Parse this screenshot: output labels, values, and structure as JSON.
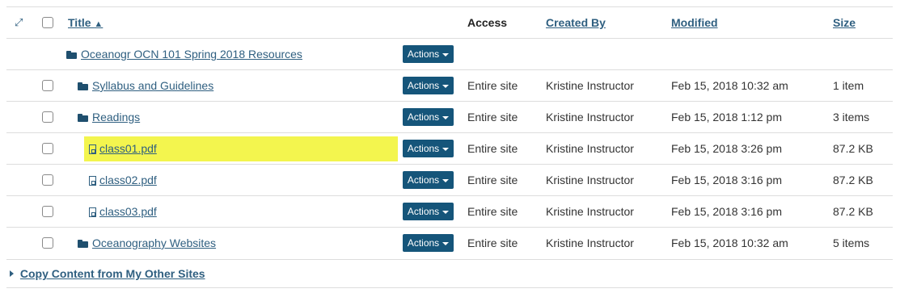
{
  "header": {
    "expand_icon": "expand-icon",
    "title": "Title",
    "access": "Access",
    "created_by": "Created By",
    "modified": "Modified",
    "size": "Size"
  },
  "rows": [
    {
      "name": "Oceanogr OCN 101 Spring 2018 Resources",
      "type": "folder-open",
      "actions": "Actions",
      "access": "",
      "created_by": "",
      "modified": "",
      "size": "",
      "has_checkbox": false
    },
    {
      "name": "Syllabus and Guidelines",
      "type": "folder",
      "actions": "Actions",
      "access": "Entire site",
      "created_by": "Kristine Instructor",
      "modified": "Feb 15, 2018 10:32 am",
      "size": "1 item",
      "has_checkbox": true
    },
    {
      "name": "Readings",
      "type": "folder-open",
      "actions": "Actions",
      "access": "Entire site",
      "created_by": "Kristine Instructor",
      "modified": "Feb 15, 2018 1:12 pm",
      "size": "3 items",
      "has_checkbox": true
    },
    {
      "name": "class01.pdf",
      "type": "pdf",
      "highlighted": true,
      "actions": "Actions",
      "access": "Entire site",
      "created_by": "Kristine Instructor",
      "modified": "Feb 15, 2018 3:26 pm",
      "size": "87.2 KB",
      "has_checkbox": true
    },
    {
      "name": "class02.pdf",
      "type": "pdf",
      "actions": "Actions",
      "access": "Entire site",
      "created_by": "Kristine Instructor",
      "modified": "Feb 15, 2018 3:16 pm",
      "size": "87.2 KB",
      "has_checkbox": true
    },
    {
      "name": "class03.pdf",
      "type": "pdf",
      "actions": "Actions",
      "access": "Entire site",
      "created_by": "Kristine Instructor",
      "modified": "Feb 15, 2018 3:16 pm",
      "size": "87.2 KB",
      "has_checkbox": true
    },
    {
      "name": "Oceanography Websites",
      "type": "folder",
      "actions": "Actions",
      "access": "Entire site",
      "created_by": "Kristine Instructor",
      "modified": "Feb 15, 2018 10:32 am",
      "size": "5 items",
      "has_checkbox": true
    }
  ],
  "footer": {
    "copy_label": "Copy Content from My Other Sites"
  },
  "colors": {
    "link": "#2f5f80",
    "button": "#15557a",
    "highlight": "#f3f54e"
  }
}
